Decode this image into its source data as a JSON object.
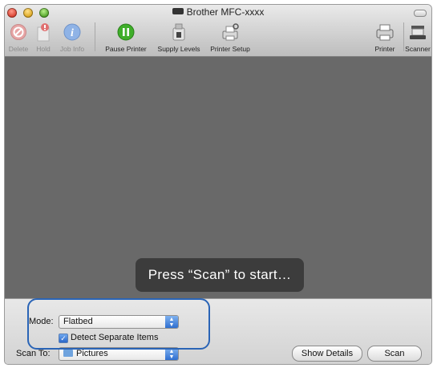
{
  "window": {
    "title": "Brother MFC-xxxx"
  },
  "toolbar": {
    "items": [
      {
        "label": "Delete",
        "icon": "delete-icon"
      },
      {
        "label": "Hold",
        "icon": "hold-icon"
      },
      {
        "label": "Job Info",
        "icon": "info-icon"
      },
      {
        "label": "Pause Printer",
        "icon": "pause-icon"
      },
      {
        "label": "Supply Levels",
        "icon": "supply-levels-icon"
      },
      {
        "label": "Printer Setup",
        "icon": "printer-setup-icon"
      },
      {
        "label": "Printer",
        "icon": "printer-icon"
      },
      {
        "label": "Scanner",
        "icon": "scanner-icon"
      }
    ]
  },
  "preview": {
    "hint": "Press “Scan” to start…"
  },
  "controls": {
    "mode_label": "Mode:",
    "mode_value": "Flatbed",
    "detect_label": "Detect Separate Items",
    "detect_checked": true,
    "scan_to_label": "Scan To:",
    "scan_to_value": "Pictures",
    "show_details_label": "Show Details",
    "scan_label": "Scan"
  },
  "colors": {
    "preview_bg": "#696969",
    "highlight": "#2a64b6",
    "accent": "#2f6fd0"
  }
}
